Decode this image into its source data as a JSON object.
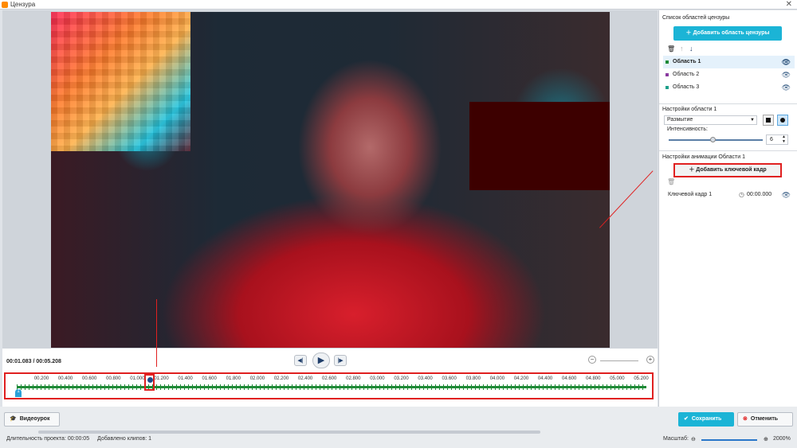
{
  "window": {
    "title": "Цензура"
  },
  "player": {
    "time": "00:01.083 / 00:05.208"
  },
  "timeline": {
    "ticks": [
      "00.200",
      "00.400",
      "00.600",
      "00.800",
      "01.000",
      "01.200",
      "01.400",
      "01.600",
      "01.800",
      "02.000",
      "02.200",
      "02.400",
      "02.600",
      "02.800",
      "03.000",
      "03.200",
      "03.400",
      "03.600",
      "03.800",
      "04.000",
      "04.200",
      "04.400",
      "04.600",
      "04.800",
      "05.000",
      "05.200"
    ],
    "start_marker": "1"
  },
  "right": {
    "list_title": "Список областей цензуры",
    "add_area": "Добавить область цензуры",
    "areas": [
      {
        "label": "Область 1",
        "color": "#1e8a36"
      },
      {
        "label": "Область 2",
        "color": "#8a3aa0"
      },
      {
        "label": "Область 3",
        "color": "#1ea08a"
      }
    ],
    "settings_title": "Настройки области 1",
    "mode": "Размытие",
    "intensity_label": "Интенсивность:",
    "intensity": "6",
    "anim_title": "Настройки анимации Области 1",
    "add_keyframe": "Добавить ключевой кадр",
    "keyframe": {
      "label": "Ключевой кадр 1",
      "time": "00:00.000"
    }
  },
  "footer": {
    "tutorial": "Видеоурок",
    "save": "Сохранить",
    "cancel": "Отменить",
    "duration_label": "Длительность проекта:",
    "duration": "00:00:05",
    "clips_label": "Добавлено клипов:",
    "clips": "1",
    "zoom_label": "Масштаб:",
    "zoom": "2000%"
  }
}
